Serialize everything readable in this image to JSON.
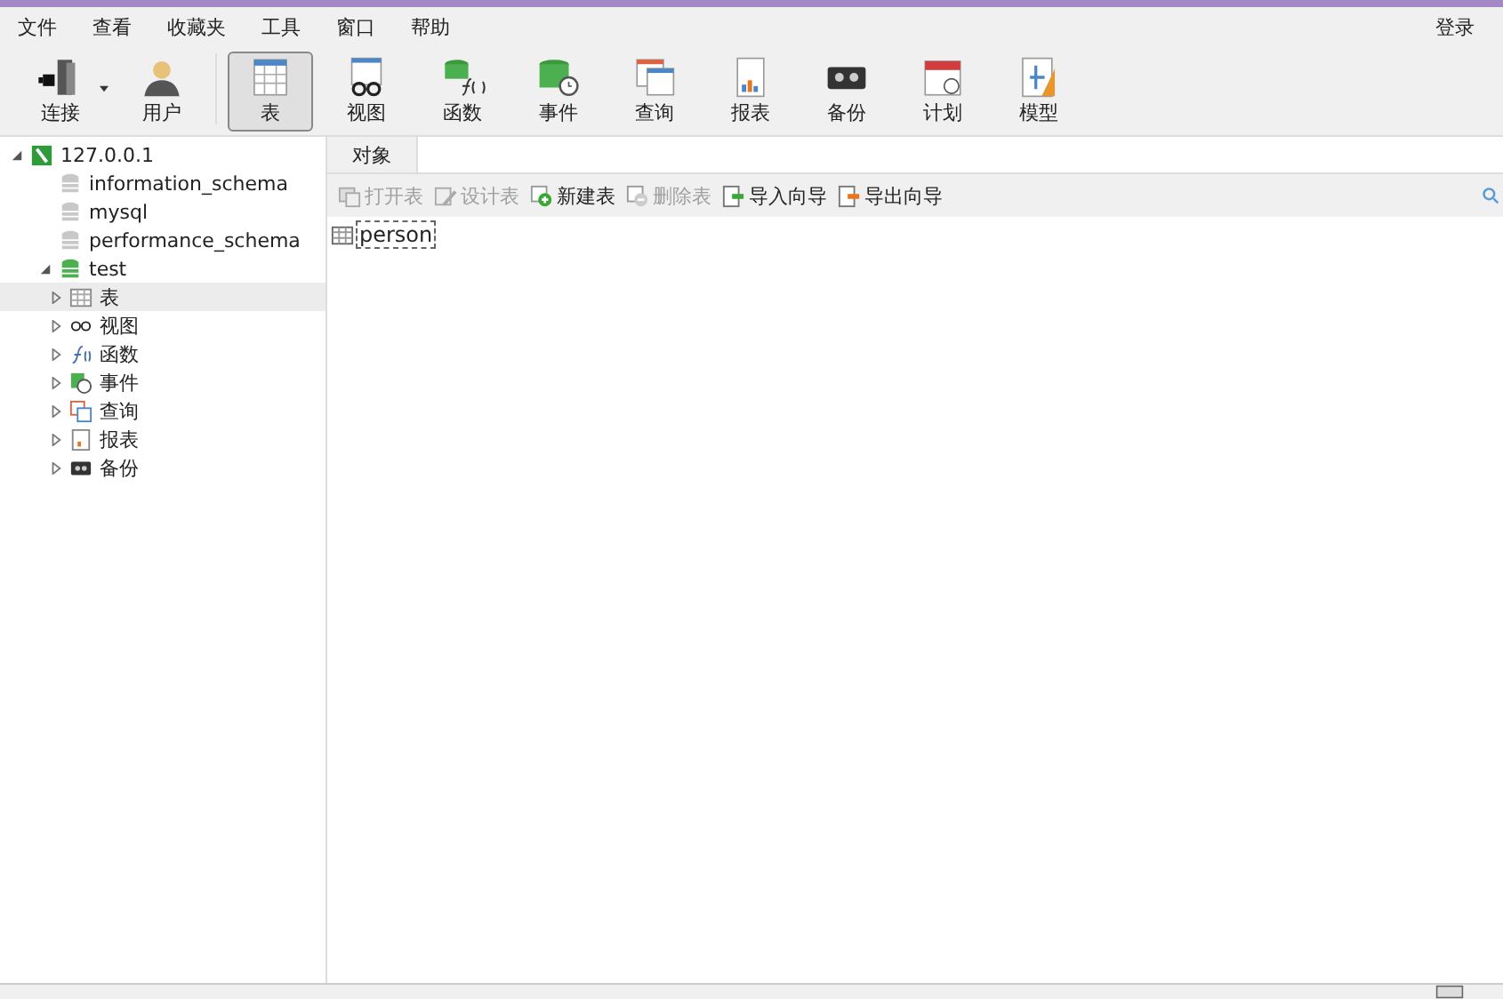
{
  "menu": [
    "文件",
    "查看",
    "收藏夹",
    "工具",
    "窗口",
    "帮助"
  ],
  "login": "登录",
  "toolbar": [
    {
      "label": "连接",
      "kind": "connect",
      "selected": false,
      "dropdown": true
    },
    {
      "label": "用户",
      "kind": "user",
      "selected": false,
      "dropdown": false
    },
    {
      "label": "表",
      "kind": "table",
      "selected": true,
      "dropdown": false
    },
    {
      "label": "视图",
      "kind": "view",
      "selected": false,
      "dropdown": false
    },
    {
      "label": "函数",
      "kind": "function",
      "selected": false,
      "dropdown": false
    },
    {
      "label": "事件",
      "kind": "event",
      "selected": false,
      "dropdown": false
    },
    {
      "label": "查询",
      "kind": "query",
      "selected": false,
      "dropdown": false
    },
    {
      "label": "报表",
      "kind": "report",
      "selected": false,
      "dropdown": false
    },
    {
      "label": "备份",
      "kind": "backup",
      "selected": false,
      "dropdown": false
    },
    {
      "label": "计划",
      "kind": "schedule",
      "selected": false,
      "dropdown": false
    },
    {
      "label": "模型",
      "kind": "model",
      "selected": false,
      "dropdown": false
    }
  ],
  "tree": [
    {
      "label": "127.0.0.1",
      "kind": "connection",
      "expanded": true,
      "selected": false,
      "children": [
        {
          "label": "information_schema",
          "kind": "database",
          "selected": false,
          "open": false
        },
        {
          "label": "mysql",
          "kind": "database",
          "selected": false,
          "open": false
        },
        {
          "label": "performance_schema",
          "kind": "database",
          "selected": false,
          "open": false
        },
        {
          "label": "test",
          "kind": "database",
          "expanded": true,
          "selected": false,
          "open": true,
          "children": [
            {
              "label": "表",
              "kind": "table",
              "expanded": false,
              "selected": true
            },
            {
              "label": "视图",
              "kind": "view",
              "expanded": false,
              "selected": false
            },
            {
              "label": "函数",
              "kind": "function",
              "expanded": false,
              "selected": false
            },
            {
              "label": "事件",
              "kind": "event",
              "expanded": false,
              "selected": false
            },
            {
              "label": "查询",
              "kind": "query",
              "expanded": false,
              "selected": false
            },
            {
              "label": "报表",
              "kind": "report",
              "expanded": false,
              "selected": false
            },
            {
              "label": "备份",
              "kind": "backup",
              "expanded": false,
              "selected": false
            }
          ]
        }
      ]
    }
  ],
  "tabs": [
    {
      "label": "对象",
      "selected": true
    }
  ],
  "object_toolbar": [
    {
      "label": "打开表",
      "kind": "open",
      "disabled": true
    },
    {
      "label": "设计表",
      "kind": "design",
      "disabled": true
    },
    {
      "label": "新建表",
      "kind": "new",
      "disabled": false
    },
    {
      "label": "删除表",
      "kind": "delete",
      "disabled": true
    },
    {
      "label": "导入向导",
      "kind": "import",
      "disabled": false
    },
    {
      "label": "导出向导",
      "kind": "export",
      "disabled": false
    }
  ],
  "objects": [
    {
      "label": "person",
      "selected": true
    }
  ]
}
